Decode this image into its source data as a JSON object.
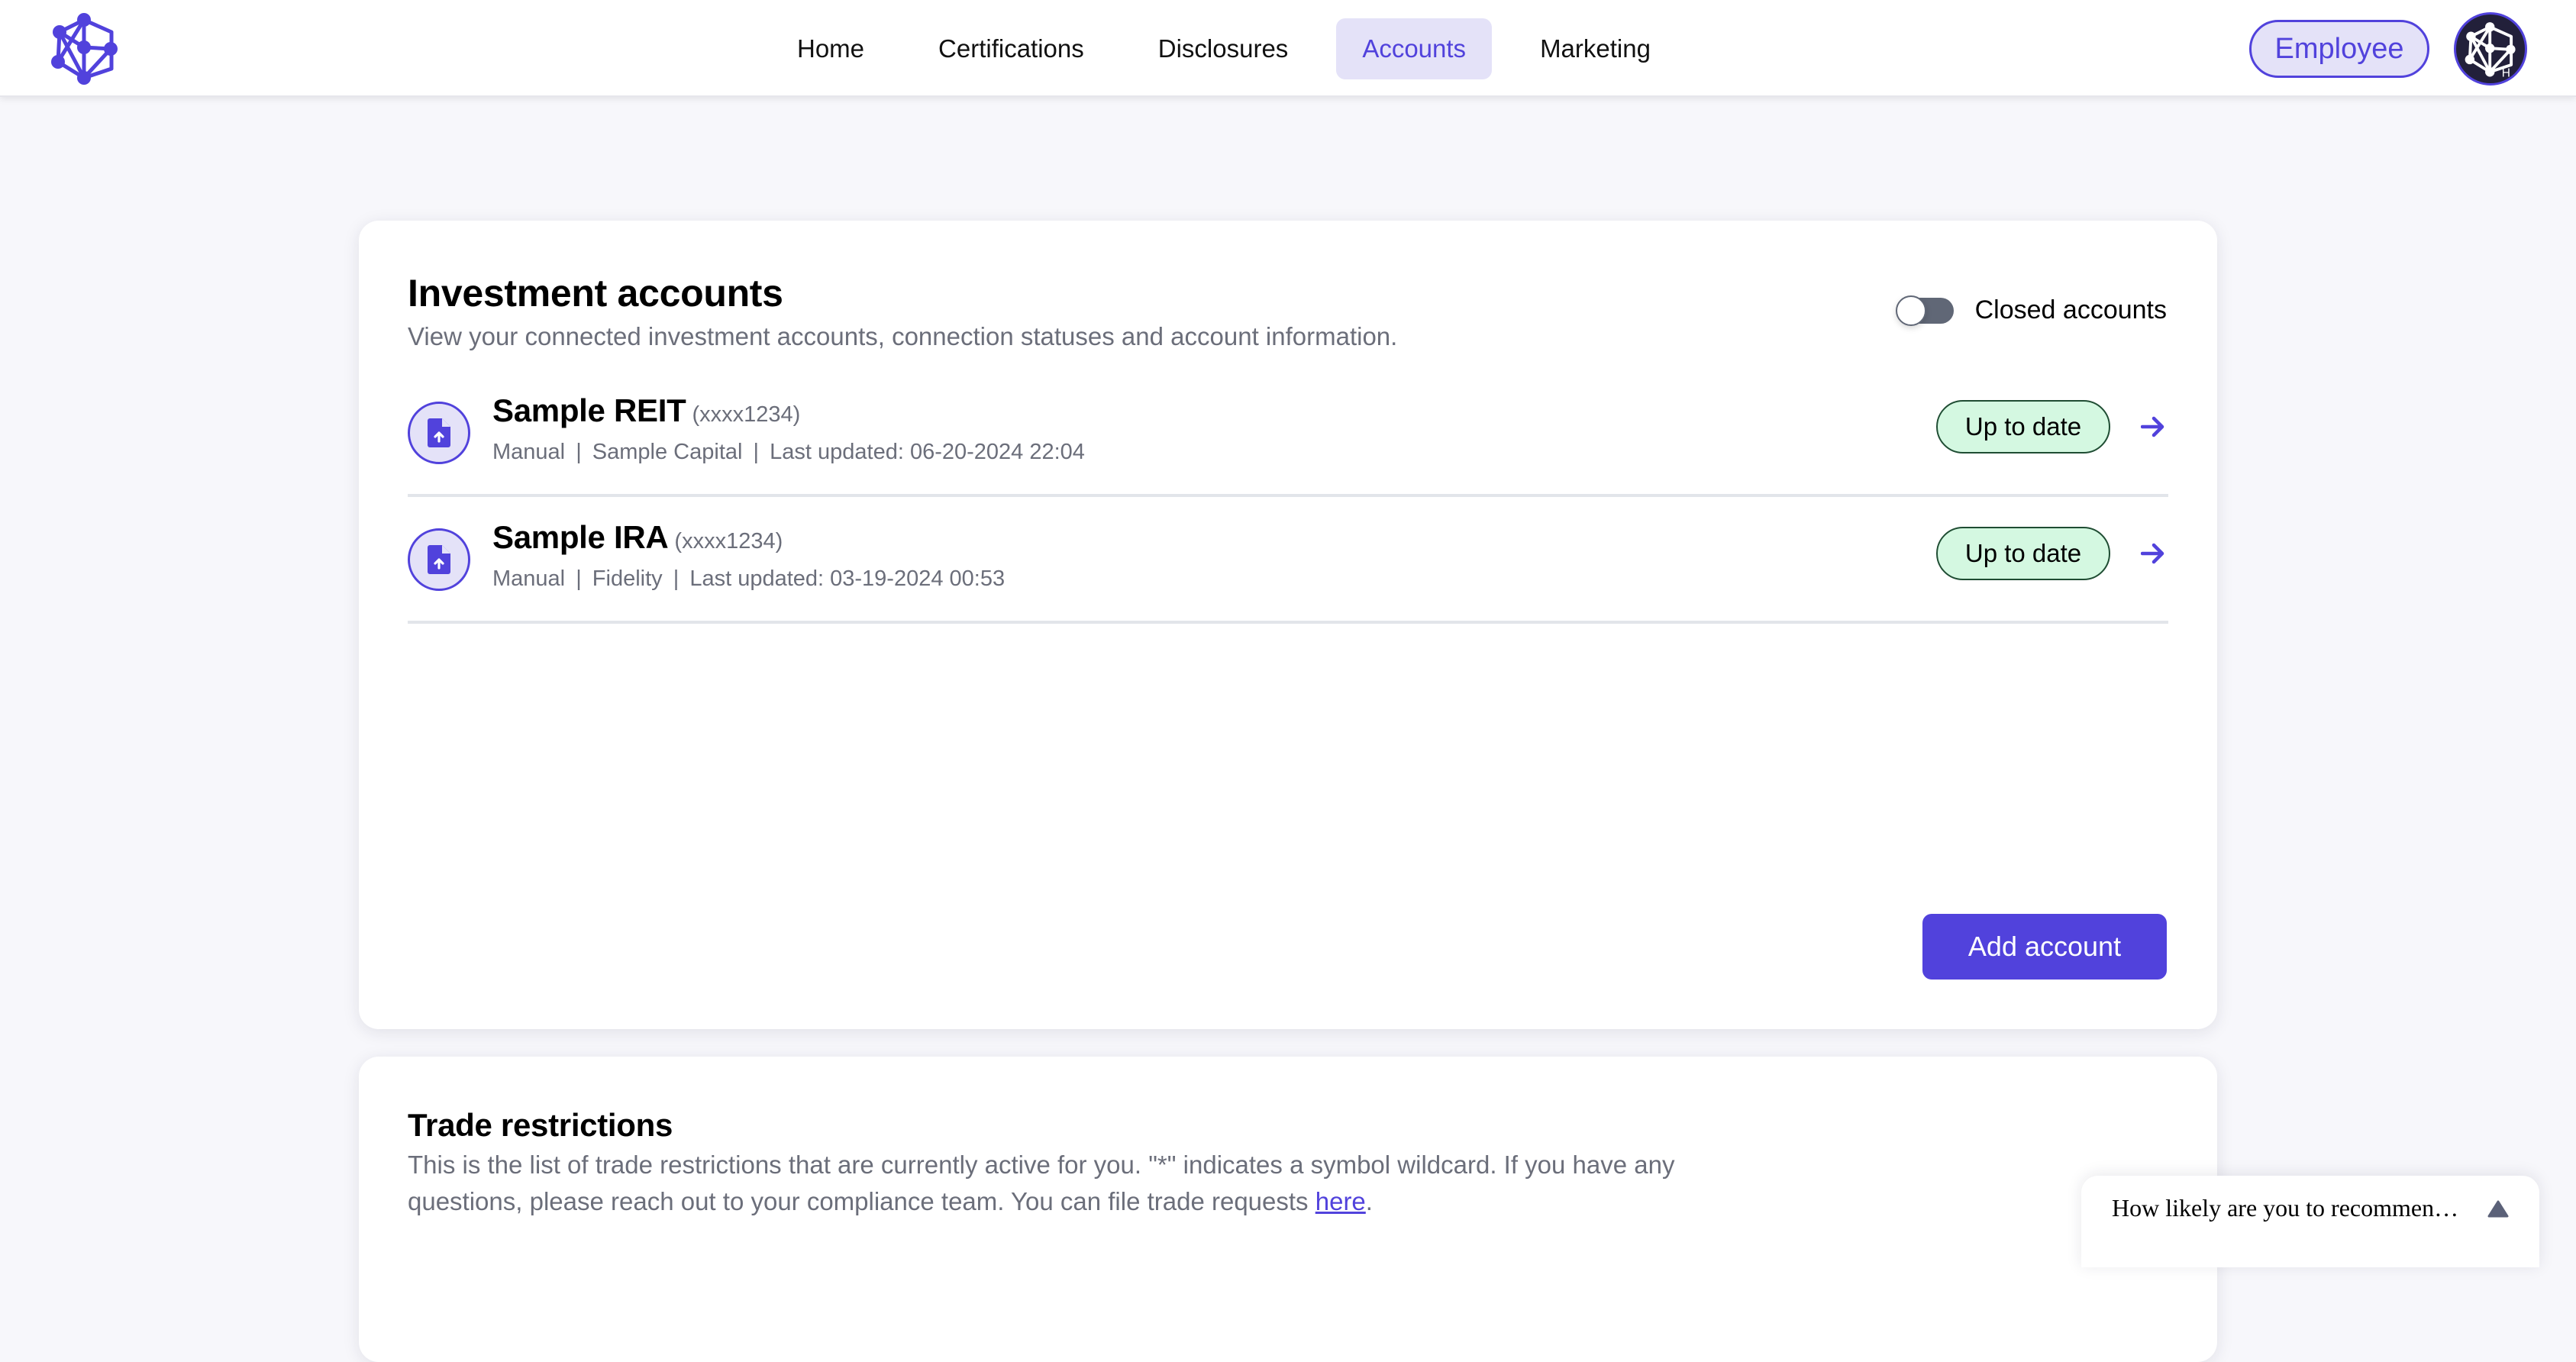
{
  "header": {
    "logo_icon": "network-molecule-logo",
    "nav": [
      {
        "label": "Home",
        "active": false
      },
      {
        "label": "Certifications",
        "active": false
      },
      {
        "label": "Disclosures",
        "active": false
      },
      {
        "label": "Accounts",
        "active": true
      },
      {
        "label": "Marketing",
        "active": false
      }
    ],
    "role_badge": "Employee",
    "avatar_initial": "H",
    "accent_color": "#5142dc"
  },
  "investment_accounts": {
    "title": "Investment accounts",
    "subtitle": "View your connected investment accounts, connection statuses and account information.",
    "closed_toggle": {
      "label": "Closed accounts",
      "on": false
    },
    "accounts": [
      {
        "name": "Sample REIT",
        "mask": "(xxxx1234)",
        "type": "Manual",
        "institution": "Sample Capital",
        "last_updated": "Last updated: 06-20-2024 22:04",
        "status": "Up to date",
        "icon": "file-upload-icon"
      },
      {
        "name": "Sample IRA",
        "mask": "(xxxx1234)",
        "type": "Manual",
        "institution": "Fidelity",
        "last_updated": "Last updated: 03-19-2024 00:53",
        "status": "Up to date",
        "icon": "file-upload-icon"
      }
    ],
    "meta_separator": "|",
    "add_button": "Add account",
    "status_color": "#d4f8e1"
  },
  "trade_restrictions": {
    "title": "Trade restrictions",
    "description_line1": "This is the list of trade restrictions that are currently active for you. \"*\" indicates a symbol wildcard. If you have any",
    "description_line2": "questions, please reach out to your compliance team. You can file trade requests ",
    "link_text": "here",
    "link_suffix": "."
  },
  "survey": {
    "question": "How likely are you to recommen…"
  }
}
